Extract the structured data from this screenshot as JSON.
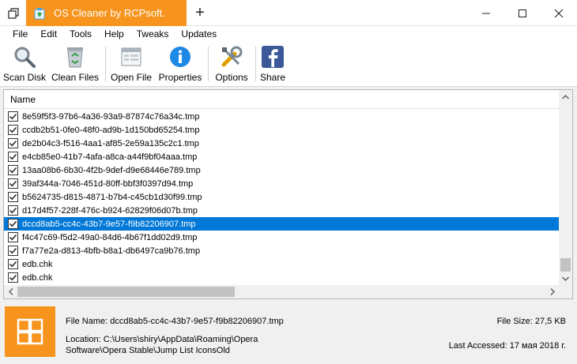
{
  "window": {
    "tab_title": "OS Cleaner by RCPsoft.",
    "new_tab_symbol": "+",
    "accent": "#f7941d"
  },
  "menu": [
    "File",
    "Edit",
    "Tools",
    "Help",
    "Tweaks",
    "Updates"
  ],
  "toolbar": {
    "scan_disk": "Scan Disk",
    "clean_files": "Clean Files",
    "open_file": "Open File",
    "properties": "Properties",
    "options": "Options",
    "share": "Share"
  },
  "list": {
    "column_name": "Name",
    "selected_index": 8,
    "files": [
      "8e59f5f3-97b6-4a36-93a9-87874c76a34c.tmp",
      "ccdb2b51-0fe0-48f0-ad9b-1d150bd65254.tmp",
      "de2b04c3-f516-4aa1-af85-2e59a135c2c1.tmp",
      "e4cb85e0-41b7-4afa-a8ca-a44f9bf04aaa.tmp",
      "13aa08b6-6b30-4f2b-9def-d9e68446e789.tmp",
      "39af344a-7046-451d-80ff-bbf3f0397d94.tmp",
      "b5624735-d815-4871-b7b4-c45cb1d30f99.tmp",
      "d17d4f57-228f-476c-b924-62829f06d07b.tmp",
      "dccd8ab5-cc4c-43b7-9e57-f9b82206907.tmp",
      "f4c47c69-f5d2-49a0-84d6-4b67f1dd02d9.tmp",
      "f7a77e2a-d813-4bfb-b8a1-db6497ca9b76.tmp",
      "edb.chk",
      "edb.chk"
    ]
  },
  "info": {
    "file_name": "File Name: dccd8ab5-cc4c-43b7-9e57-f9b82206907.tmp",
    "file_size": "File Size: 27,5 KB",
    "location_line1": "Location: C:\\Users\\shiry\\AppData\\Roaming\\Opera",
    "location_line2": "Software\\Opera Stable\\Jump List IconsOld",
    "last_accessed": "Last Accessed: 17 мая 2018 г."
  }
}
